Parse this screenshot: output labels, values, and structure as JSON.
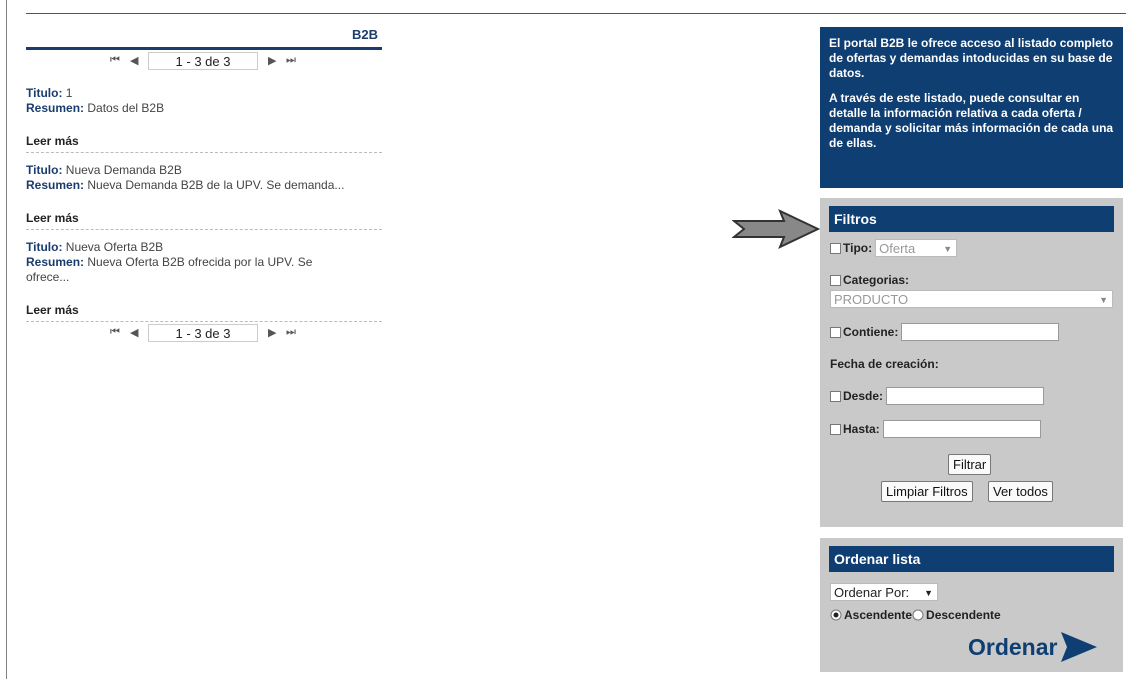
{
  "b2b": {
    "title": "B2B"
  },
  "pager": {
    "status": "1 - 3 de 3",
    "first": "⏮",
    "prev": "◀",
    "next": "▶",
    "last": "⏭"
  },
  "items": [
    {
      "titulo_label": "Titulo:",
      "titulo": "1",
      "resumen_label": "Resumen:",
      "resumen": "Datos del B2B",
      "leer": "Leer más"
    },
    {
      "titulo_label": "Titulo:",
      "titulo": "Nueva Demanda B2B",
      "resumen_label": "Resumen:",
      "resumen": "Nueva Demanda B2B de la UPV. Se demanda...",
      "leer": "Leer más"
    },
    {
      "titulo_label": "Titulo:",
      "titulo": "Nueva Oferta B2B",
      "resumen_label": "Resumen:",
      "resumen": "Nueva Oferta B2B ofrecida por la UPV. Se ofrece...",
      "leer": "Leer más"
    }
  ],
  "info": {
    "p1": "El portal B2B le ofrece acceso al listado completo de ofertas y demandas intoducidas en su base de datos.",
    "p2": "A través de este listado, puede consultar en detalle la información relativa a cada oferta / demanda y solicitar más información de cada una de ellas."
  },
  "filtros": {
    "title": "Filtros",
    "tipo_label": "Tipo:",
    "tipo_value": "Oferta",
    "categorias_label": "Categorias:",
    "categorias_value": "PRODUCTO",
    "contiene_label": "Contiene:",
    "fecha_label": "Fecha de creación:",
    "desde_label": "Desde:",
    "hasta_label": "Hasta:",
    "filtrar": "Filtrar",
    "limpiar": "Limpiar Filtros",
    "ver_todos": "Ver todos"
  },
  "ordenar": {
    "title": "Ordenar lista",
    "select_value": "Ordenar Por:",
    "asc": "Ascendente",
    "desc": "Descendente",
    "button": "Ordenar"
  },
  "colors": {
    "navy": "#0f3e72",
    "panel": "#c9c9c9"
  },
  "icons": {
    "callout": "gray-arrow-right-icon",
    "ordenar": "play-triangle-icon"
  }
}
